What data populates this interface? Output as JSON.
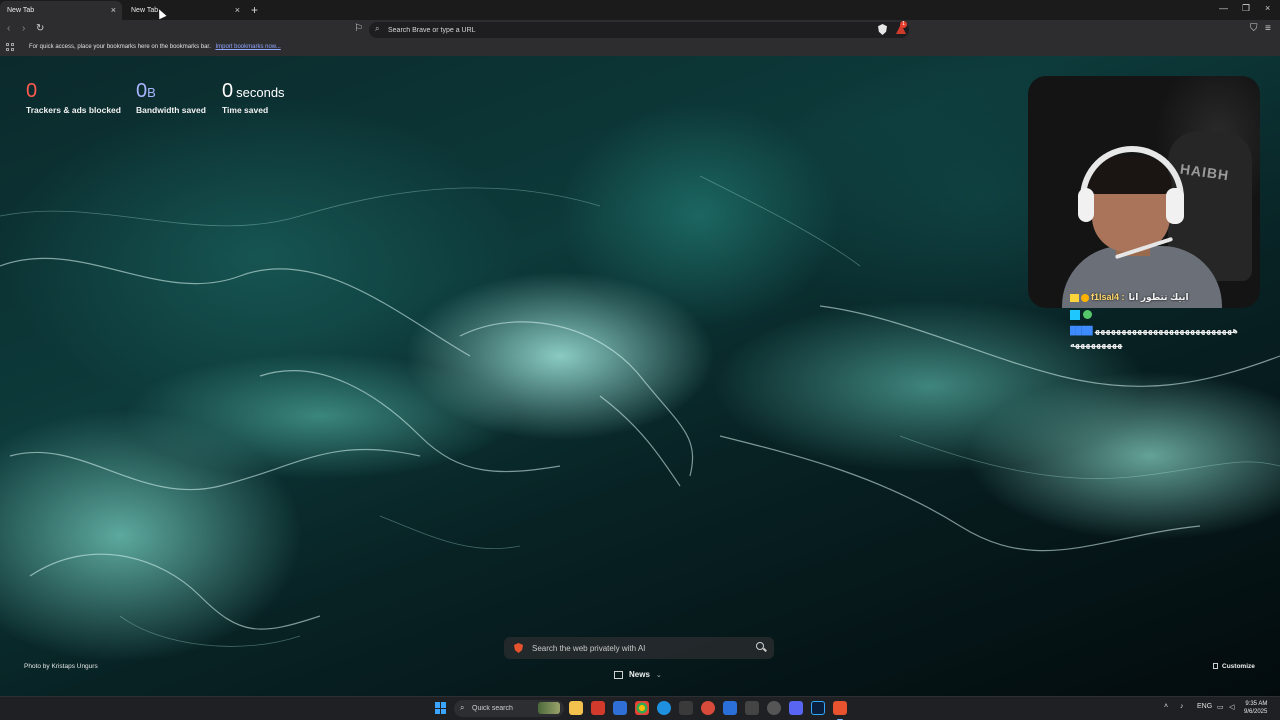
{
  "tabs": [
    {
      "label": "New Tab"
    },
    {
      "label": "New Tab"
    }
  ],
  "toolbar": {
    "url_placeholder": "Search Brave or type a URL",
    "rewards_count": "1"
  },
  "bookmarks_bar": {
    "message": "For quick access, place your bookmarks here on the bookmarks bar.",
    "import_link": "Import bookmarks now..."
  },
  "stats": {
    "trackers": {
      "value": "0",
      "label": "Trackers & ads blocked"
    },
    "bandwidth": {
      "value": "0",
      "unit": "B",
      "label": "Bandwidth saved"
    },
    "time": {
      "value": "0",
      "unit": "seconds",
      "label": "Time saved"
    }
  },
  "webcam": {
    "chair_text": "HAIBH"
  },
  "chat": {
    "line1_user": "f1lsal4 :",
    "line1_message": "ابيك تتطور انا",
    "line3_message": "ههههههههههههههههههههههههههههههههههههه"
  },
  "ai_search": {
    "placeholder": "Search the web privately with AI"
  },
  "news": {
    "label": "News"
  },
  "photo_credit": "Photo by Kristaps Ungurs",
  "customize": {
    "label": "Customize"
  },
  "taskbar": {
    "search_placeholder": "Quick search",
    "language": "ENG",
    "time": "9:35 AM",
    "date": "9/6/2025"
  },
  "colors": {
    "trackers_accent": "#ff5a4e",
    "bandwidth_accent": "#a8b4ff",
    "link": "#8fa6ff",
    "brave_orange": "#e8532f"
  }
}
